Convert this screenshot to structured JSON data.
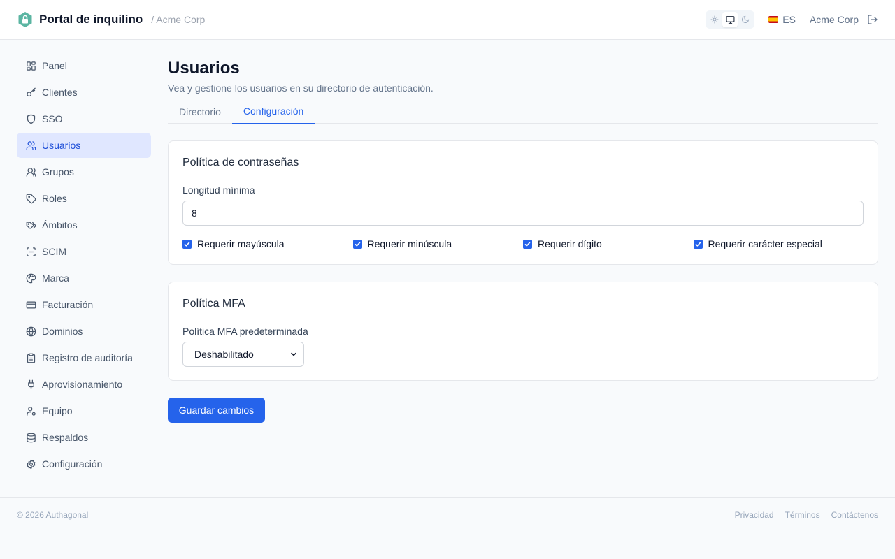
{
  "header": {
    "app_title": "Portal de inquilino",
    "breadcrumb": "/ Acme Corp",
    "theme_options": [
      "sun-icon",
      "monitor-icon",
      "moon-icon"
    ],
    "theme_selected": "monitor-icon",
    "language": "ES",
    "org_name": "Acme Corp"
  },
  "sidebar": {
    "items": [
      {
        "label": "Panel",
        "icon": "dashboard-icon"
      },
      {
        "label": "Clientes",
        "icon": "key-icon"
      },
      {
        "label": "SSO",
        "icon": "shield-icon"
      },
      {
        "label": "Usuarios",
        "icon": "users-icon",
        "active": true
      },
      {
        "label": "Grupos",
        "icon": "group-icon"
      },
      {
        "label": "Roles",
        "icon": "tag-icon"
      },
      {
        "label": "Ámbitos",
        "icon": "tags-icon"
      },
      {
        "label": "SCIM",
        "icon": "scan-icon"
      },
      {
        "label": "Marca",
        "icon": "palette-icon"
      },
      {
        "label": "Facturación",
        "icon": "credit-card-icon"
      },
      {
        "label": "Dominios",
        "icon": "globe-icon"
      },
      {
        "label": "Registro de auditoría",
        "icon": "clipboard-icon"
      },
      {
        "label": "Aprovisionamiento",
        "icon": "plug-icon"
      },
      {
        "label": "Equipo",
        "icon": "user-cog-icon"
      },
      {
        "label": "Respaldos",
        "icon": "database-icon"
      },
      {
        "label": "Configuración",
        "icon": "gear-icon"
      }
    ]
  },
  "main": {
    "title": "Usuarios",
    "description": "Vea y gestione los usuarios en su directorio de autenticación.",
    "tabs": [
      {
        "label": "Directorio"
      },
      {
        "label": "Configuración",
        "active": true
      }
    ],
    "password_policy": {
      "title": "Política de contraseñas",
      "min_length_label": "Longitud mínima",
      "min_length_value": "8",
      "checks": [
        {
          "label": "Requerir mayúscula",
          "checked": true
        },
        {
          "label": "Requerir minúscula",
          "checked": true
        },
        {
          "label": "Requerir dígito",
          "checked": true
        },
        {
          "label": "Requerir carácter especial",
          "checked": true
        }
      ]
    },
    "mfa_policy": {
      "title": "Política MFA",
      "default_label": "Política MFA predeterminada",
      "default_value": "Deshabilitado"
    },
    "save_label": "Guardar cambios"
  },
  "footer": {
    "copyright": "© 2026 Authagonal",
    "links": [
      "Privacidad",
      "Términos",
      "Contáctenos"
    ]
  },
  "colors": {
    "accent": "#2563eb",
    "active_nav_bg": "#e0e7ff",
    "logo": "#5bb5a2"
  }
}
